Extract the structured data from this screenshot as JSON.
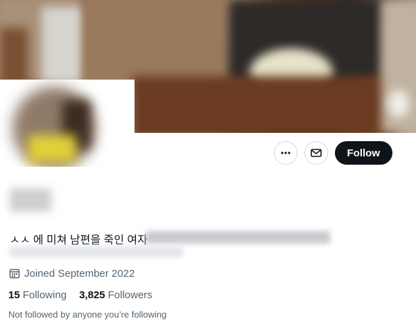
{
  "profile": {
    "bio": "ㅅㅅ 에 미쳐 남편을 죽인 여자",
    "joined": "Joined September 2022",
    "following": {
      "count": "15",
      "label": "Following"
    },
    "followers": {
      "count": "3,825",
      "label": "Followers"
    },
    "not_followed": "Not followed by anyone you’re following"
  },
  "actions": {
    "more_icon": "more-horizontal-icon",
    "message_icon": "envelope-icon",
    "follow_label": "Follow"
  },
  "icons": {
    "calendar": "calendar-icon"
  },
  "colors": {
    "primary_text": "#0f1419",
    "secondary_text": "#536471",
    "follow_bg": "#0f1419",
    "border": "#cfd9de"
  }
}
